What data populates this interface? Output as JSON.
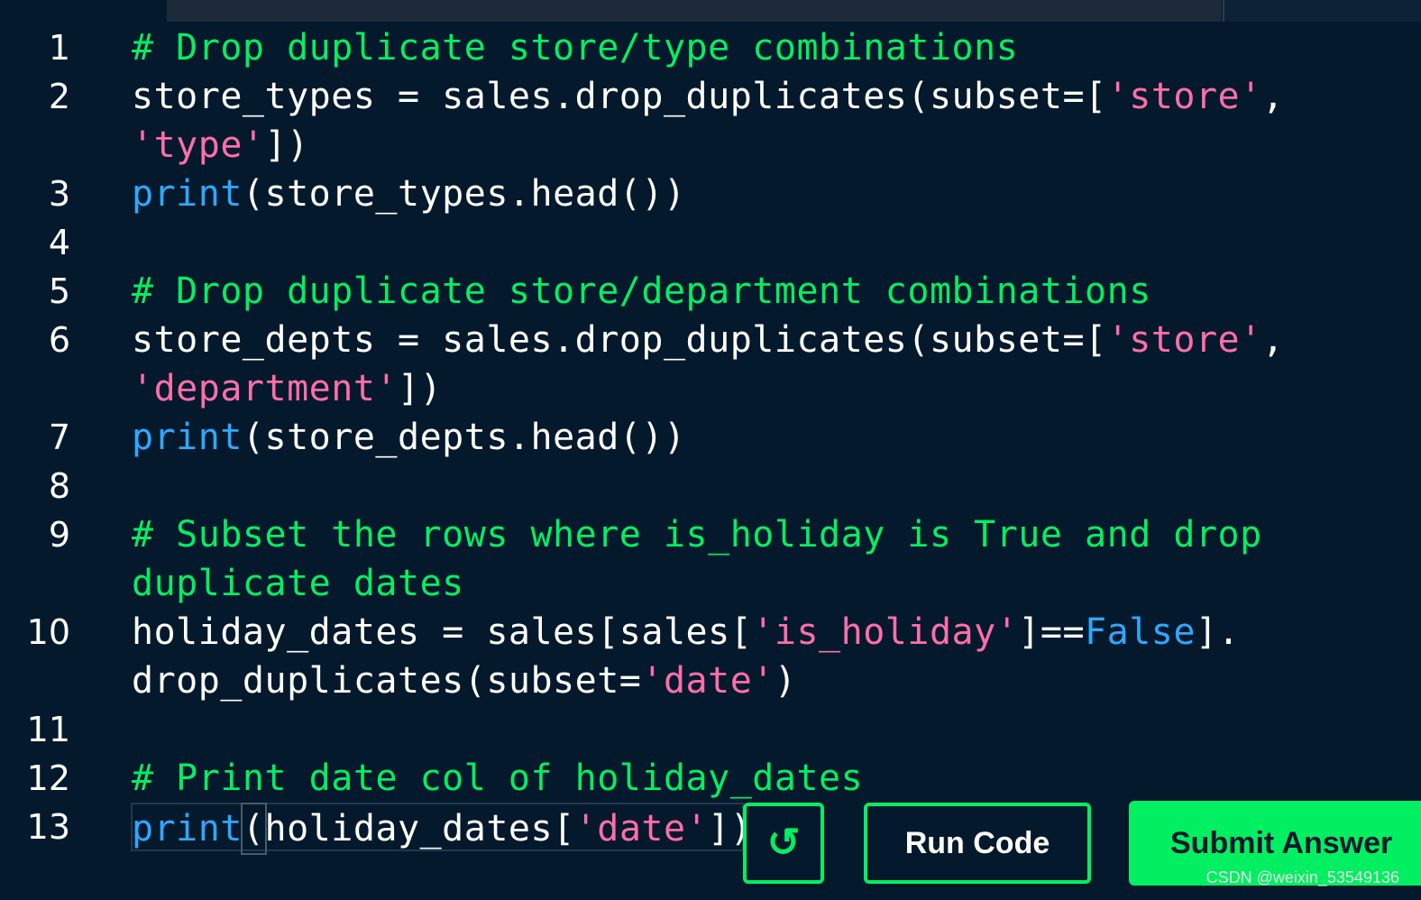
{
  "lines": [
    {
      "num": "1",
      "text": "# Drop duplicate store/type combinations"
    },
    {
      "num": "2",
      "a": "store_types = sales.drop_duplicates(subset=[",
      "s1": "'store'",
      "b": ","
    },
    {
      "num": "",
      "s1": "'type'",
      "b": "])"
    },
    {
      "num": "3",
      "kw": "print",
      "b": "(store_types.head())"
    },
    {
      "num": "4"
    },
    {
      "num": "5",
      "text": "# Drop duplicate store/department combinations"
    },
    {
      "num": "6",
      "a": "store_depts = sales.drop_duplicates(subset=[",
      "s1": "'store'",
      "b": ","
    },
    {
      "num": "",
      "s1": "'department'",
      "b": "])"
    },
    {
      "num": "7",
      "kw": "print",
      "b": "(store_depts.head())"
    },
    {
      "num": "8"
    },
    {
      "num": "9",
      "text": "# Subset the rows where is_holiday is True and drop"
    },
    {
      "num": "",
      "text": "duplicate dates"
    },
    {
      "num": "10",
      "a": "holiday_dates = sales[sales[",
      "s1": "'is_holiday'",
      "b": "]==",
      "kw": "False",
      "c": "]."
    },
    {
      "num": "",
      "a": "drop_duplicates(subset=",
      "s1": "'date'",
      "b": ")"
    },
    {
      "num": "11"
    },
    {
      "num": "12",
      "text": "# Print date col of holiday_dates"
    },
    {
      "num": "13",
      "kw": "print",
      "p": "(",
      "a": "holiday_dates[",
      "s1": "'date'",
      "b": "])"
    }
  ],
  "buttons": {
    "reset_icon": "↺",
    "run_label": "Run Code",
    "submit_label": "Submit Answer"
  },
  "watermark": "CSDN @weixin_53549136"
}
